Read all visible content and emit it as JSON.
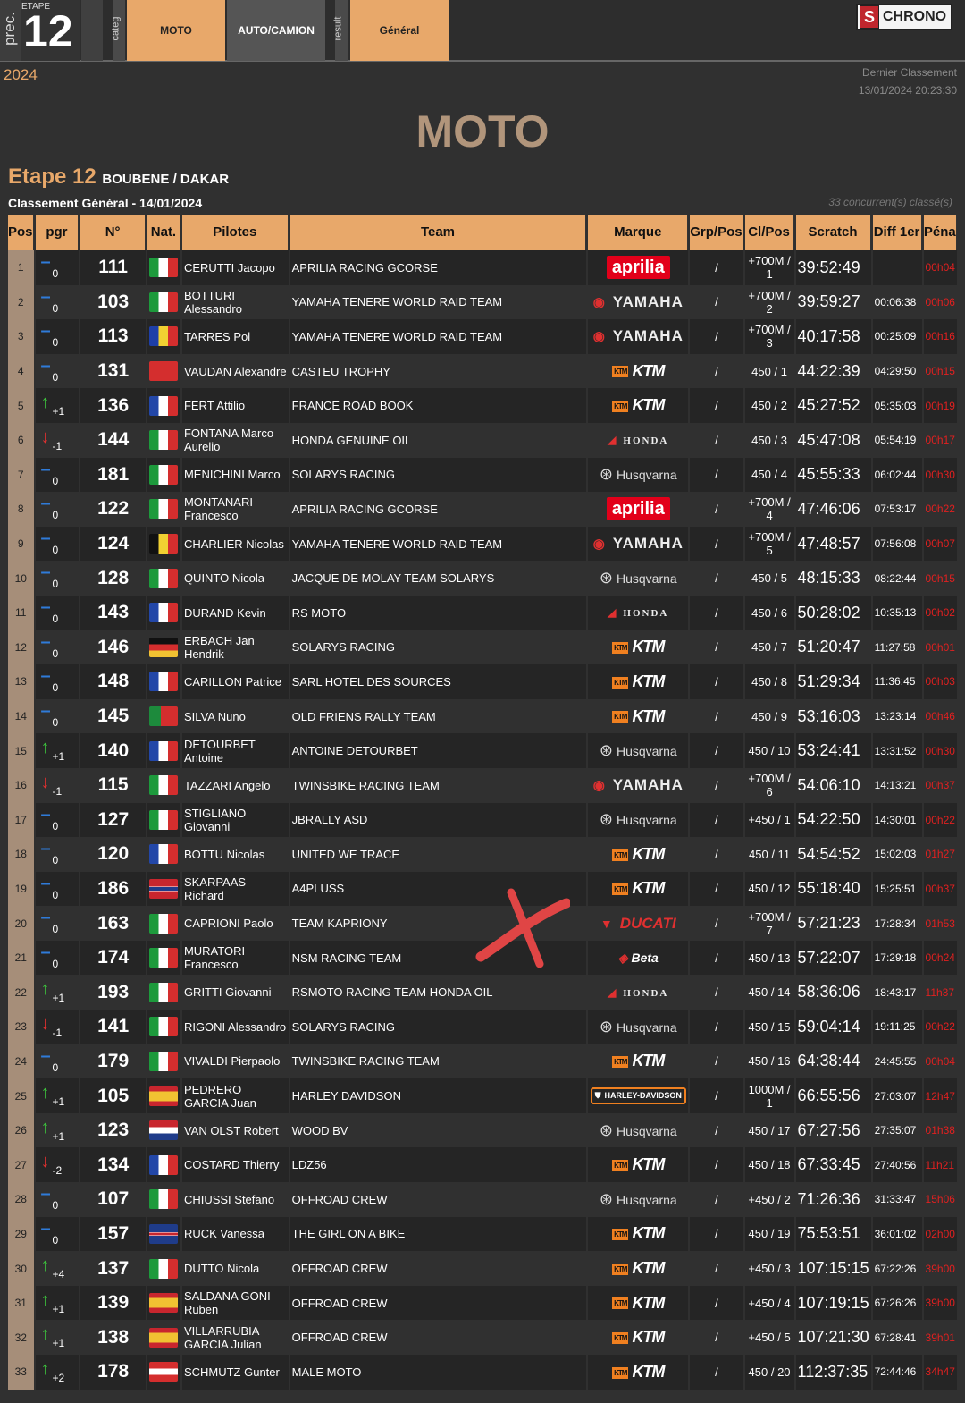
{
  "nav": {
    "prec_label": "prec.",
    "etape_label": "ETAPE",
    "etape_number": "12",
    "categ_label": "categ",
    "moto_label": "MOTO",
    "auto_label": "AUTO/CAMION",
    "result_label": "result",
    "general_label": "Général",
    "logo_text": "CHRONO",
    "logo_mark": "S"
  },
  "header": {
    "year": "2024",
    "dernier_label": "Dernier Classement",
    "dernier_date": "13/01/2024 20:23:30",
    "big_title": "MOTO",
    "etape_title": "Etape 12",
    "etape_route": "BOUBENE / DAKAR",
    "classement": "Classement Général - 14/01/2024",
    "concurrents": "33 concurrent(s) classé(s)"
  },
  "columns": [
    "Pos",
    "pgr",
    "N°",
    "Nat.",
    "Pilotes",
    "Team",
    "Marque",
    "Grp/Pos",
    "Cl/Pos",
    "Scratch",
    "Diff 1er",
    "Péna"
  ],
  "colors": {
    "accent": "#e8a86a",
    "title": "#b1957b",
    "penalty": "#e02020",
    "up": "#3dbf3d",
    "down": "#e03030",
    "equal": "#2f7bd9"
  },
  "rows": [
    {
      "pos": "1",
      "trend": "eq",
      "pgr": "0",
      "num": "111",
      "flag": "italy",
      "pilot": "CERUTTI Jacopo",
      "team": "APRILIA RACING GCORSE",
      "brand": "aprilia",
      "brand_text": "aprilia",
      "grp": "/",
      "cl": "+700M / 1",
      "scratch": "39:52:49",
      "diff": "",
      "pena": "00h04"
    },
    {
      "pos": "2",
      "trend": "eq",
      "pgr": "0",
      "num": "103",
      "flag": "italy",
      "pilot": "BOTTURI Alessandro",
      "team": "YAMAHA TENERE WORLD RAID TEAM",
      "brand": "yamaha",
      "brand_text": "YAMAHA",
      "grp": "/",
      "cl": "+700M / 2",
      "scratch": "39:59:27",
      "diff": "00:06:38",
      "pena": "00h06"
    },
    {
      "pos": "3",
      "trend": "eq",
      "pgr": "0",
      "num": "113",
      "flag": "andorra",
      "pilot": "TARRES Pol",
      "team": "YAMAHA TENERE WORLD RAID TEAM",
      "brand": "yamaha",
      "brand_text": "YAMAHA",
      "grp": "/",
      "cl": "+700M / 3",
      "scratch": "40:17:58",
      "diff": "00:25:09",
      "pena": "00h16"
    },
    {
      "pos": "4",
      "trend": "eq",
      "pgr": "0",
      "num": "131",
      "flag": "swiss",
      "pilot": "VAUDAN Alexandre",
      "team": "CASTEU TROPHY",
      "brand": "ktm",
      "brand_text": "KTM",
      "grp": "/",
      "cl": "450 / 1",
      "scratch": "44:22:39",
      "diff": "04:29:50",
      "pena": "00h15"
    },
    {
      "pos": "5",
      "trend": "up",
      "pgr": "+1",
      "num": "136",
      "flag": "france",
      "pilot": "FERT Attilio",
      "team": "FRANCE ROAD BOOK",
      "brand": "ktm",
      "brand_text": "KTM",
      "grp": "/",
      "cl": "450 / 2",
      "scratch": "45:27:52",
      "diff": "05:35:03",
      "pena": "00h19"
    },
    {
      "pos": "6",
      "trend": "down",
      "pgr": "-1",
      "num": "144",
      "flag": "italy",
      "pilot": "FONTANA Marco Aurelio",
      "team": "HONDA GENUINE OIL",
      "brand": "honda",
      "brand_text": "HONDA",
      "grp": "/",
      "cl": "450 / 3",
      "scratch": "45:47:08",
      "diff": "05:54:19",
      "pena": "00h17"
    },
    {
      "pos": "7",
      "trend": "eq",
      "pgr": "0",
      "num": "181",
      "flag": "italy",
      "pilot": "MENICHINI Marco",
      "team": "SOLARYS RACING",
      "brand": "husq",
      "brand_text": "Husqvarna",
      "grp": "/",
      "cl": "450 / 4",
      "scratch": "45:55:33",
      "diff": "06:02:44",
      "pena": "00h30"
    },
    {
      "pos": "8",
      "trend": "eq",
      "pgr": "0",
      "num": "122",
      "flag": "italy",
      "pilot": "MONTANARI Francesco",
      "team": "APRILIA RACING GCORSE",
      "brand": "aprilia",
      "brand_text": "aprilia",
      "grp": "/",
      "cl": "+700M / 4",
      "scratch": "47:46:06",
      "diff": "07:53:17",
      "pena": "00h22"
    },
    {
      "pos": "9",
      "trend": "eq",
      "pgr": "0",
      "num": "124",
      "flag": "belgium",
      "pilot": "CHARLIER Nicolas",
      "team": "YAMAHA TENERE WORLD RAID TEAM",
      "brand": "yamaha",
      "brand_text": "YAMAHA",
      "grp": "/",
      "cl": "+700M / 5",
      "scratch": "47:48:57",
      "diff": "07:56:08",
      "pena": "00h07"
    },
    {
      "pos": "10",
      "trend": "eq",
      "pgr": "0",
      "num": "128",
      "flag": "italy",
      "pilot": "QUINTO Nicola",
      "team": "JACQUE DE MOLAY TEAM SOLARYS",
      "brand": "husq",
      "brand_text": "Husqvarna",
      "grp": "/",
      "cl": "450 / 5",
      "scratch": "48:15:33",
      "diff": "08:22:44",
      "pena": "00h15"
    },
    {
      "pos": "11",
      "trend": "eq",
      "pgr": "0",
      "num": "143",
      "flag": "france",
      "pilot": "DURAND Kevin",
      "team": "RS MOTO",
      "brand": "honda",
      "brand_text": "HONDA",
      "grp": "/",
      "cl": "450 / 6",
      "scratch": "50:28:02",
      "diff": "10:35:13",
      "pena": "00h02"
    },
    {
      "pos": "12",
      "trend": "eq",
      "pgr": "0",
      "num": "146",
      "flag": "germany",
      "pilot": "ERBACH Jan Hendrik",
      "team": "SOLARYS RACING",
      "brand": "ktm",
      "brand_text": "KTM",
      "grp": "/",
      "cl": "450 / 7",
      "scratch": "51:20:47",
      "diff": "11:27:58",
      "pena": "00h01"
    },
    {
      "pos": "13",
      "trend": "eq",
      "pgr": "0",
      "num": "148",
      "flag": "france",
      "pilot": "CARILLON Patrice",
      "team": "SARL HOTEL DES SOURCES",
      "brand": "ktm",
      "brand_text": "KTM",
      "grp": "/",
      "cl": "450 / 8",
      "scratch": "51:29:34",
      "diff": "11:36:45",
      "pena": "00h03"
    },
    {
      "pos": "14",
      "trend": "eq",
      "pgr": "0",
      "num": "145",
      "flag": "portugal",
      "pilot": "SILVA Nuno",
      "team": "OLD FRIENS RALLY TEAM",
      "brand": "ktm",
      "brand_text": "KTM",
      "grp": "/",
      "cl": "450 / 9",
      "scratch": "53:16:03",
      "diff": "13:23:14",
      "pena": "00h46"
    },
    {
      "pos": "15",
      "trend": "up",
      "pgr": "+1",
      "num": "140",
      "flag": "france",
      "pilot": "DETOURBET Antoine",
      "team": "ANTOINE DETOURBET",
      "brand": "husq",
      "brand_text": "Husqvarna",
      "grp": "/",
      "cl": "450 / 10",
      "scratch": "53:24:41",
      "diff": "13:31:52",
      "pena": "00h30"
    },
    {
      "pos": "16",
      "trend": "down",
      "pgr": "-1",
      "num": "115",
      "flag": "italy",
      "pilot": "TAZZARI Angelo",
      "team": "TWINSBIKE RACING TEAM",
      "brand": "yamaha",
      "brand_text": "YAMAHA",
      "grp": "/",
      "cl": "+700M / 6",
      "scratch": "54:06:10",
      "diff": "14:13:21",
      "pena": "00h37"
    },
    {
      "pos": "17",
      "trend": "eq",
      "pgr": "0",
      "num": "127",
      "flag": "italy",
      "pilot": "STIGLIANO Giovanni",
      "team": "JBRALLY ASD",
      "brand": "husq",
      "brand_text": "Husqvarna",
      "grp": "/",
      "cl": "+450 / 1",
      "scratch": "54:22:50",
      "diff": "14:30:01",
      "pena": "00h22"
    },
    {
      "pos": "18",
      "trend": "eq",
      "pgr": "0",
      "num": "120",
      "flag": "france",
      "pilot": "BOTTU Nicolas",
      "team": "UNITED WE TRACE",
      "brand": "ktm",
      "brand_text": "KTM",
      "grp": "/",
      "cl": "450 / 11",
      "scratch": "54:54:52",
      "diff": "15:02:03",
      "pena": "01h27"
    },
    {
      "pos": "19",
      "trend": "eq",
      "pgr": "0",
      "num": "186",
      "flag": "norway",
      "pilot": "SKARPAAS Richard",
      "team": "A4PLUSS",
      "brand": "ktm",
      "brand_text": "KTM",
      "grp": "/",
      "cl": "450 / 12",
      "scratch": "55:18:40",
      "diff": "15:25:51",
      "pena": "00h37"
    },
    {
      "pos": "20",
      "trend": "eq",
      "pgr": "0",
      "num": "163",
      "flag": "italy",
      "pilot": "CAPRIONI Paolo",
      "team": "TEAM KAPRIONY",
      "brand": "ducati",
      "brand_text": "DUCATI",
      "grp": "/",
      "cl": "+700M / 7",
      "scratch": "57:21:23",
      "diff": "17:28:34",
      "pena": "01h53"
    },
    {
      "pos": "21",
      "trend": "eq",
      "pgr": "0",
      "num": "174",
      "flag": "italy",
      "pilot": "MURATORI Francesco",
      "team": "NSM RACING TEAM",
      "brand": "beta",
      "brand_text": "Beta",
      "grp": "/",
      "cl": "450 / 13",
      "scratch": "57:22:07",
      "diff": "17:29:18",
      "pena": "00h24"
    },
    {
      "pos": "22",
      "trend": "up",
      "pgr": "+1",
      "num": "193",
      "flag": "italy",
      "pilot": "GRITTI Giovanni",
      "team": "RSMOTO RACING TEAM HONDA OIL",
      "brand": "honda",
      "brand_text": "HONDA",
      "grp": "/",
      "cl": "450 / 14",
      "scratch": "58:36:06",
      "diff": "18:43:17",
      "pena": "11h37"
    },
    {
      "pos": "23",
      "trend": "down",
      "pgr": "-1",
      "num": "141",
      "flag": "italy",
      "pilot": "RIGONI Alessandro",
      "team": "SOLARYS RACING",
      "brand": "husq",
      "brand_text": "Husqvarna",
      "grp": "/",
      "cl": "450 / 15",
      "scratch": "59:04:14",
      "diff": "19:11:25",
      "pena": "00h22"
    },
    {
      "pos": "24",
      "trend": "eq",
      "pgr": "0",
      "num": "179",
      "flag": "italy",
      "pilot": "VIVALDI Pierpaolo",
      "team": "TWINSBIKE RACING TEAM",
      "brand": "ktm",
      "brand_text": "KTM",
      "grp": "/",
      "cl": "450 / 16",
      "scratch": "64:38:44",
      "diff": "24:45:55",
      "pena": "00h04"
    },
    {
      "pos": "25",
      "trend": "up",
      "pgr": "+1",
      "num": "105",
      "flag": "spain",
      "pilot": "PEDRERO GARCIA Juan",
      "team": "HARLEY DAVIDSON",
      "brand": "hd",
      "brand_text": "HARLEY-DAVIDSON",
      "grp": "/",
      "cl": "1000M / 1",
      "scratch": "66:55:56",
      "diff": "27:03:07",
      "pena": "12h47"
    },
    {
      "pos": "26",
      "trend": "up",
      "pgr": "+1",
      "num": "123",
      "flag": "netherlands",
      "pilot": "VAN OLST Robert",
      "team": "WOOD BV",
      "brand": "husq",
      "brand_text": "Husqvarna",
      "grp": "/",
      "cl": "450 / 17",
      "scratch": "67:27:56",
      "diff": "27:35:07",
      "pena": "01h38"
    },
    {
      "pos": "27",
      "trend": "down",
      "pgr": "-2",
      "num": "134",
      "flag": "france",
      "pilot": "COSTARD Thierry",
      "team": "LDZ56",
      "brand": "ktm",
      "brand_text": "KTM",
      "grp": "/",
      "cl": "450 / 18",
      "scratch": "67:33:45",
      "diff": "27:40:56",
      "pena": "11h21"
    },
    {
      "pos": "28",
      "trend": "eq",
      "pgr": "0",
      "num": "107",
      "flag": "italy",
      "pilot": "CHIUSSI Stefano",
      "team": "OFFROAD CREW",
      "brand": "husq",
      "brand_text": "Husqvarna",
      "grp": "/",
      "cl": "+450 / 2",
      "scratch": "71:26:36",
      "diff": "31:33:47",
      "pena": "15h06"
    },
    {
      "pos": "29",
      "trend": "eq",
      "pgr": "0",
      "num": "157",
      "flag": "uk",
      "pilot": "RUCK Vanessa",
      "team": "THE GIRL ON A BIKE",
      "brand": "ktm",
      "brand_text": "KTM",
      "grp": "/",
      "cl": "450 / 19",
      "scratch": "75:53:51",
      "diff": "36:01:02",
      "pena": "02h00"
    },
    {
      "pos": "30",
      "trend": "up",
      "pgr": "+4",
      "num": "137",
      "flag": "italy",
      "pilot": "DUTTO Nicola",
      "team": "OFFROAD CREW",
      "brand": "ktm",
      "brand_text": "KTM",
      "grp": "/",
      "cl": "+450 / 3",
      "scratch": "107:15:15",
      "diff": "67:22:26",
      "pena": "39h00"
    },
    {
      "pos": "31",
      "trend": "up",
      "pgr": "+1",
      "num": "139",
      "flag": "spain",
      "pilot": "SALDANA GONI Ruben",
      "team": "OFFROAD CREW",
      "brand": "ktm",
      "brand_text": "KTM",
      "grp": "/",
      "cl": "+450 / 4",
      "scratch": "107:19:15",
      "diff": "67:26:26",
      "pena": "39h00"
    },
    {
      "pos": "32",
      "trend": "up",
      "pgr": "+1",
      "num": "138",
      "flag": "spain",
      "pilot": "VILLARRUBIA GARCIA Julian",
      "team": "OFFROAD CREW",
      "brand": "ktm",
      "brand_text": "KTM",
      "grp": "/",
      "cl": "+450 / 5",
      "scratch": "107:21:30",
      "diff": "67:28:41",
      "pena": "39h01"
    },
    {
      "pos": "33",
      "trend": "up",
      "pgr": "+2",
      "num": "178",
      "flag": "austria",
      "pilot": "SCHMUTZ Gunter",
      "team": "MALE MOTO",
      "brand": "ktm",
      "brand_text": "KTM",
      "grp": "/",
      "cl": "450 / 20",
      "scratch": "112:37:35",
      "diff": "72:44:46",
      "pena": "34h47"
    }
  ]
}
